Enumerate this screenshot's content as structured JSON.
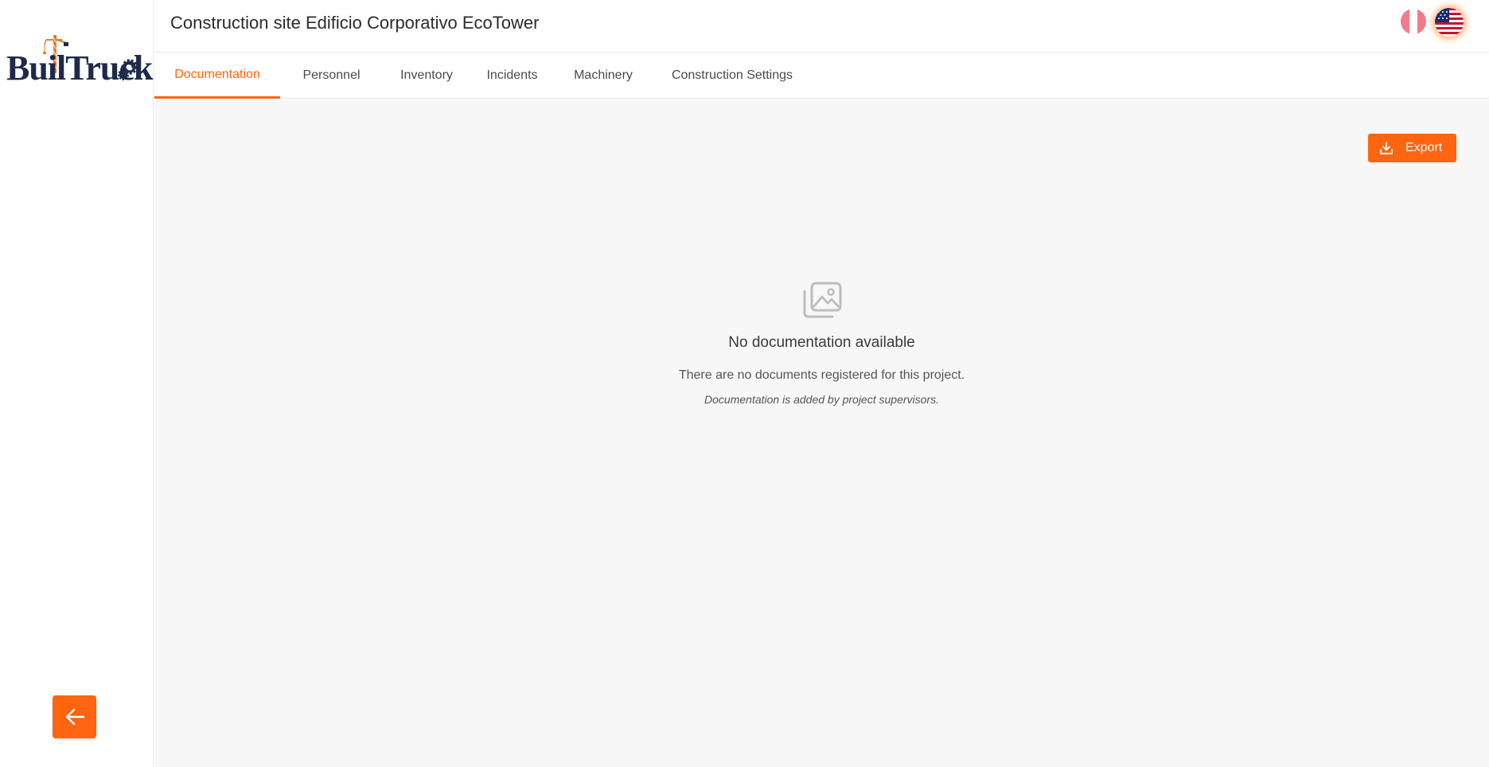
{
  "brand": {
    "name": "BuilTruck",
    "accent_color": "#ff6410",
    "navy_color": "#1f2a4a"
  },
  "header": {
    "title": "Construction site Edificio Corporativo EcoTower",
    "languages": [
      {
        "name": "peru-flag-icon",
        "selected": false
      },
      {
        "name": "us-flag-icon",
        "selected": true
      }
    ]
  },
  "tabs": [
    {
      "label": "Documentation",
      "active": true
    },
    {
      "label": "Personnel",
      "active": false
    },
    {
      "label": "Inventory",
      "active": false
    },
    {
      "label": "Incidents",
      "active": false
    },
    {
      "label": "Machinery",
      "active": false
    },
    {
      "label": "Construction Settings",
      "active": false
    }
  ],
  "toolbar": {
    "export_label": "Export",
    "export_icon": "download-icon"
  },
  "empty_state": {
    "icon": "images-icon",
    "title": "No documentation available",
    "description": "There are no documents registered for this project.",
    "note": "Documentation is added by project supervisors."
  },
  "sidebar": {
    "back_icon": "arrow-left-icon"
  }
}
